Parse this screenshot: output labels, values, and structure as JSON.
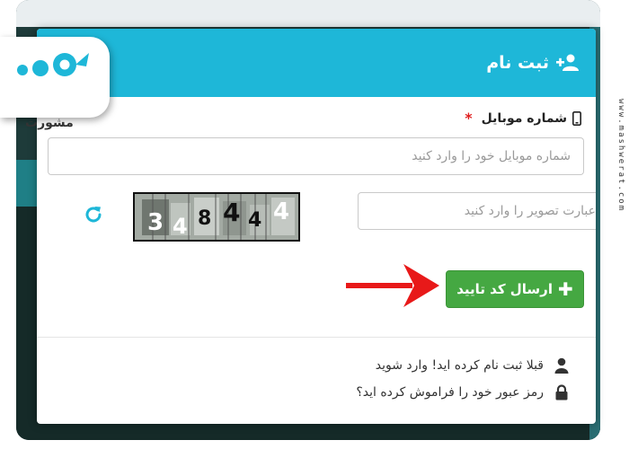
{
  "modal": {
    "title": "ثبت نام",
    "mobile_label": "شماره موبایل",
    "required_mark": "*",
    "mobile_placeholder": "شماره موبایل خود را وارد کنید",
    "captcha_placeholder": "عبارت تصویر را وارد کنید",
    "captcha_code": "348444",
    "submit_label": "ارسال کد تایید",
    "login_link": "قبلا ثبت نام کرده اید! وارد شوید",
    "forgot_link": "رمز عبور خود را فراموش کرده اید؟"
  },
  "brand": {
    "logo_text": "مشورت",
    "watermark": "www.mashwerat.com"
  },
  "colors": {
    "header": "#1eb7d8",
    "submit": "#45a842",
    "required": "#e02020",
    "refresh": "#1eb7d8",
    "arrow": "#e81919",
    "logo": "#1eb7d8"
  },
  "icons": {
    "title_icon": "user-plus-icon",
    "label_icon": "mobile-phone-icon",
    "refresh": "refresh-icon",
    "submit_icon": "plus-icon",
    "login_icon": "user-icon",
    "forgot_icon": "lock-icon"
  }
}
